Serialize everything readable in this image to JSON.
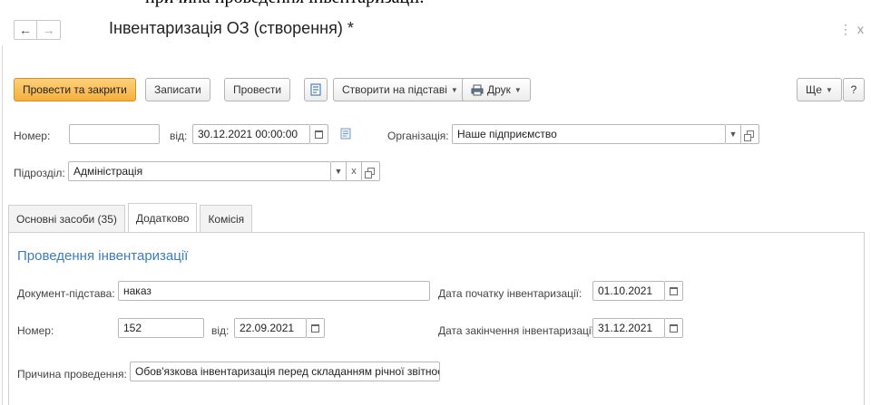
{
  "overflow_text": "причина проведення інвентаризації.",
  "window": {
    "title": "Інвентаризація ОЗ (створення) *",
    "menu_label": "⋮",
    "close_label": "x",
    "back_icon": "arrow-left-icon",
    "forward_icon": "arrow-right-icon"
  },
  "toolbar": {
    "post_close": "Провести та закрити",
    "save": "Записати",
    "post": "Провести",
    "create_based": "Створити на підставі",
    "print": "Друк",
    "more": "Ще",
    "help": "?",
    "primary_color": "#f5b03b"
  },
  "header": {
    "number_label": "Номер:",
    "number_value": "",
    "date_label": "від:",
    "date_value": "30.12.2021 00:00:00",
    "org_label": "Організація:",
    "org_value": "Наше підприємство",
    "dept_label": "Підрозділ:",
    "dept_value": "Адміністрація",
    "clear_label": "x"
  },
  "tabs": [
    {
      "label": "Основні засоби (35)",
      "active": false
    },
    {
      "label": "Додатково",
      "active": true
    },
    {
      "label": "Комісія",
      "active": false
    }
  ],
  "details": {
    "section_title": "Проведення інвентаризації",
    "basis_label": "Документ-підстава:",
    "basis_value": "наказ",
    "number_label": "Номер:",
    "number_value": "152",
    "date_label": "від:",
    "date_value": "22.09.2021",
    "start_label": "Дата початку інвентаризації:",
    "start_value": "01.10.2021",
    "end_label": "Дата закінчення інвентаризації:",
    "end_value": "31.12.2021",
    "reason_label": "Причина проведення:",
    "reason_value": "Обов'язкова інвентаризація перед складанням річної звітності",
    "accent_color": "#3c7cc0"
  }
}
